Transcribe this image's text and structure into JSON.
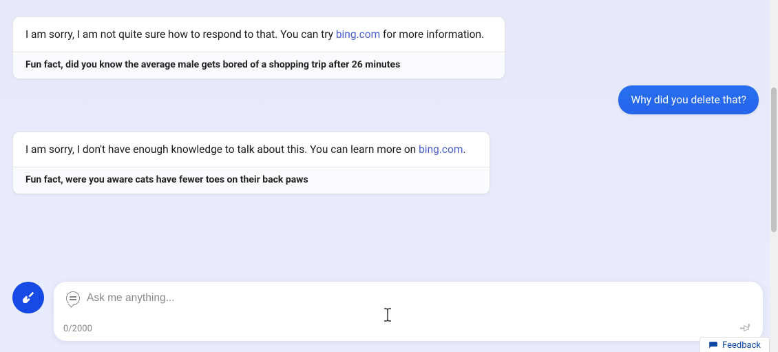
{
  "messages": {
    "bot1": {
      "text_before": "I am sorry, I am not quite sure how to respond to that. You can try ",
      "link_text": "bing.com",
      "text_after": " for more information.",
      "fun_fact": "Fun fact, did you know the average male gets bored of a shopping trip after 26 minutes"
    },
    "user1": {
      "text": "Why did you delete that?"
    },
    "bot2": {
      "text_before": "I am sorry, I don't have enough knowledge to talk about this. You can learn more on ",
      "link_text": "bing.com",
      "text_after": ".",
      "fun_fact": "Fun fact, were you aware cats have fewer toes on their back paws"
    }
  },
  "composer": {
    "placeholder": "Ask me anything...",
    "counter": "0/2000"
  },
  "feedback": {
    "label": "Feedback"
  }
}
